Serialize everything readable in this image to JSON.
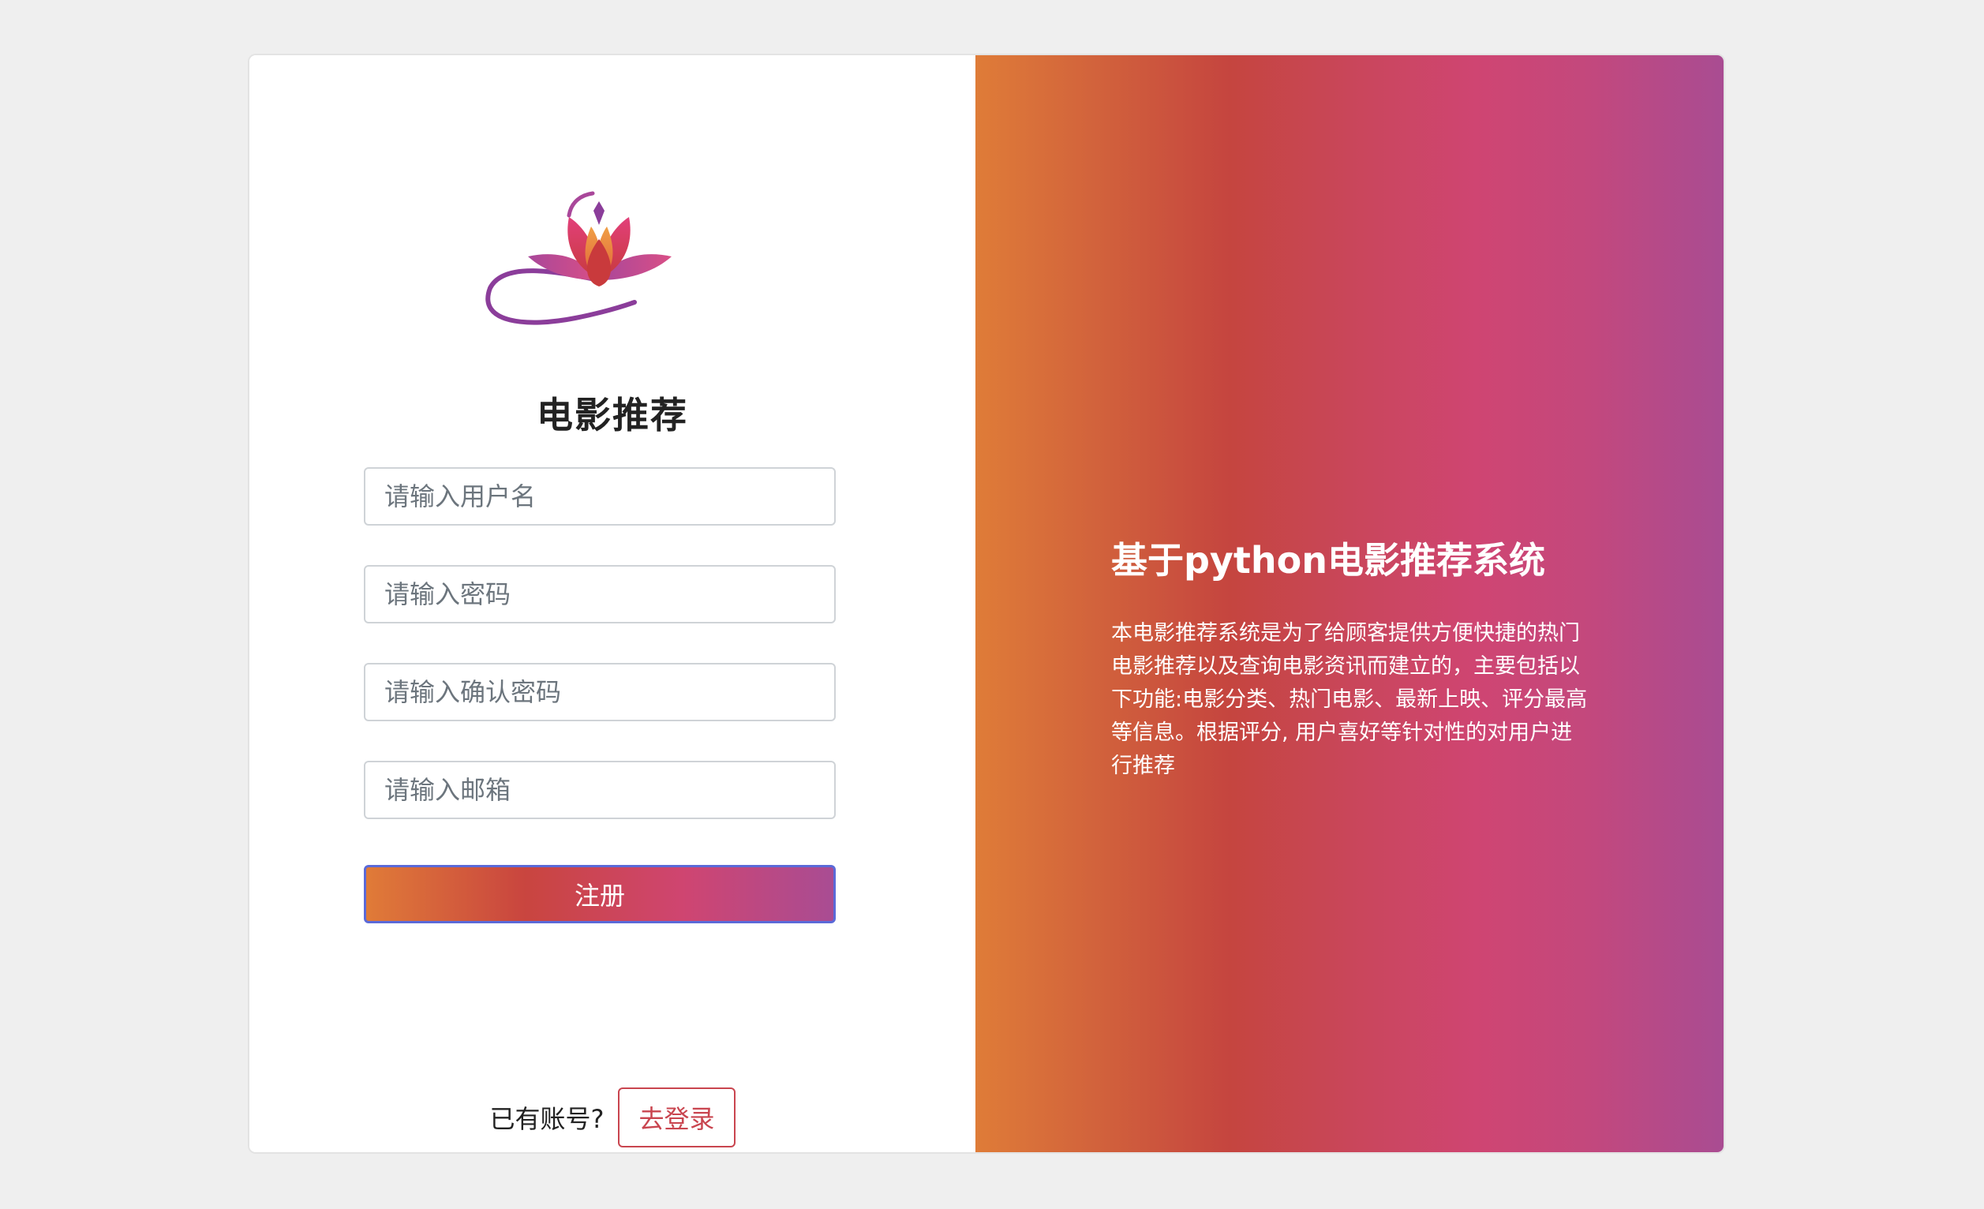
{
  "brand": {
    "title": "电影推荐",
    "logo": "lotus-logo"
  },
  "form": {
    "username_placeholder": "请输入用户名",
    "password_placeholder": "请输入密码",
    "confirm_placeholder": "请输入确认密码",
    "email_placeholder": "请输入邮箱",
    "submit_label": "注册"
  },
  "footer": {
    "prompt": "已有账号?",
    "login_label": "去登录"
  },
  "info": {
    "title": "基于python电影推荐系统",
    "description": "本电影推荐系统是为了给顾客提供方便快捷的热门电影推荐以及查询电影资讯而建立的，主要包括以下功能:电影分类、热门电影、最新上映、评分最高等信息。根据评分, 用户喜好等针对性的对用户进行推荐"
  },
  "colors": {
    "gradient": [
      "#df7c38",
      "#c5453f",
      "#cf4572",
      "#a94c92"
    ],
    "login_accent": "#c9454f",
    "submit_border": "#5b6ad8"
  }
}
